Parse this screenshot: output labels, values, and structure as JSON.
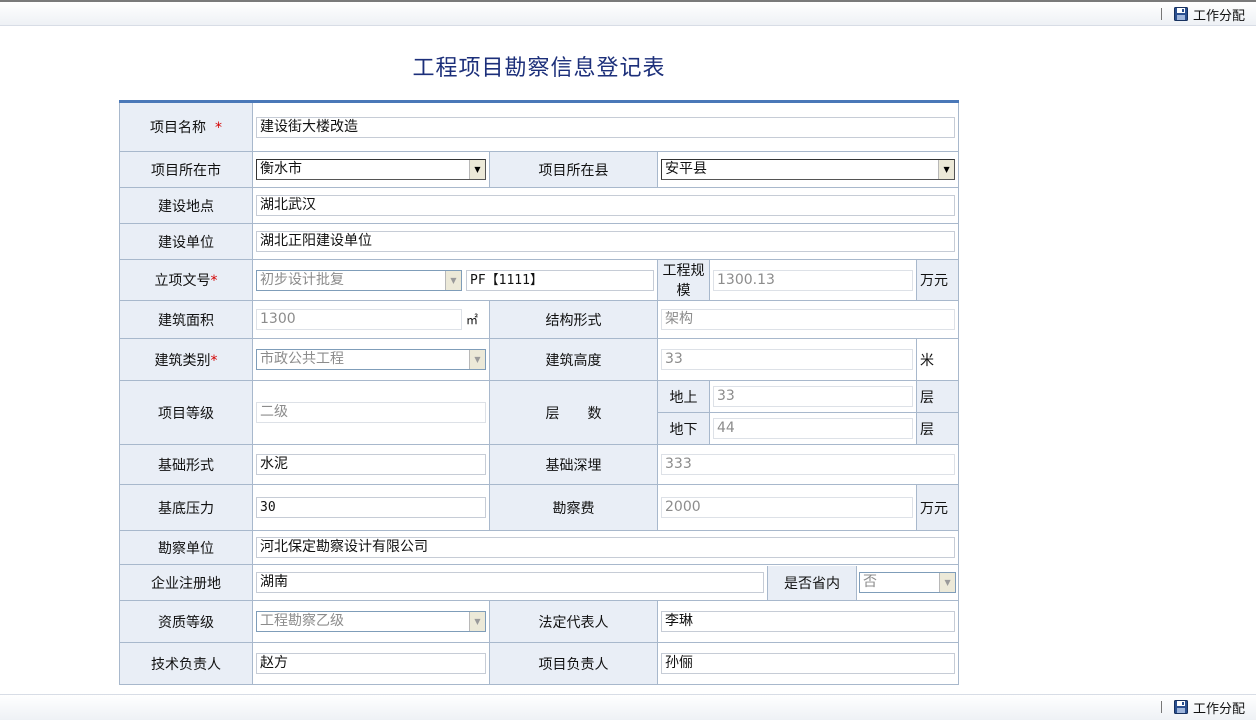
{
  "toolbar": {
    "assign_label": "工作分配",
    "save_icon": "floppy-disk-icon"
  },
  "page": {
    "title": "工程项目勘察信息登记表"
  },
  "form": {
    "project_name": {
      "label": "项目名称",
      "required_mark": "*",
      "value": "建设街大楼改造"
    },
    "project_city": {
      "label": "项目所在市",
      "value": "衡水市"
    },
    "project_county": {
      "label": "项目所在县",
      "value": "安平县"
    },
    "build_location": {
      "label": "建设地点",
      "value": "湖北武汉"
    },
    "build_unit": {
      "label": "建设单位",
      "value": "湖北正阳建设单位"
    },
    "approval_doc": {
      "label": "立项文号",
      "required_mark": "*",
      "select_value": "初步设计批复",
      "number_value": "PF【1111】"
    },
    "engineering_scale": {
      "label": "工程规模",
      "value": "1300.13",
      "unit": "万元"
    },
    "building_area": {
      "label": "建筑面积",
      "value": "1300",
      "unit": "㎡"
    },
    "structure_form": {
      "label": "结构形式",
      "value": "架构"
    },
    "building_type": {
      "label": "建筑类别",
      "required_mark": "*",
      "value": "市政公共工程"
    },
    "building_height": {
      "label": "建筑高度",
      "value": "33",
      "unit": "米"
    },
    "project_grade": {
      "label": "项目等级",
      "value": "二级"
    },
    "floors": {
      "label": "层　　数",
      "above": {
        "label": "地上",
        "value": "33",
        "unit": "层"
      },
      "below": {
        "label": "地下",
        "value": "44",
        "unit": "层"
      }
    },
    "foundation_form": {
      "label": "基础形式",
      "value": "水泥"
    },
    "foundation_depth": {
      "label": "基础深埋",
      "value": "333"
    },
    "base_pressure": {
      "label": "基底压力",
      "value": "30"
    },
    "survey_fee": {
      "label": "勘察费",
      "value": "2000",
      "unit": "万元"
    },
    "survey_unit": {
      "label": "勘察单位",
      "value": "河北保定勘察设计有限公司"
    },
    "registered_place": {
      "label": "企业注册地",
      "value": "湖南"
    },
    "in_province": {
      "label": "是否省内",
      "value": "否"
    },
    "qualification": {
      "label": "资质等级",
      "value": "工程勘察乙级"
    },
    "legal_rep": {
      "label": "法定代表人",
      "value": "李琳"
    },
    "tech_lead": {
      "label": "技术负责人",
      "value": "赵方"
    },
    "project_lead": {
      "label": "项目负责人",
      "value": "孙俪"
    }
  }
}
